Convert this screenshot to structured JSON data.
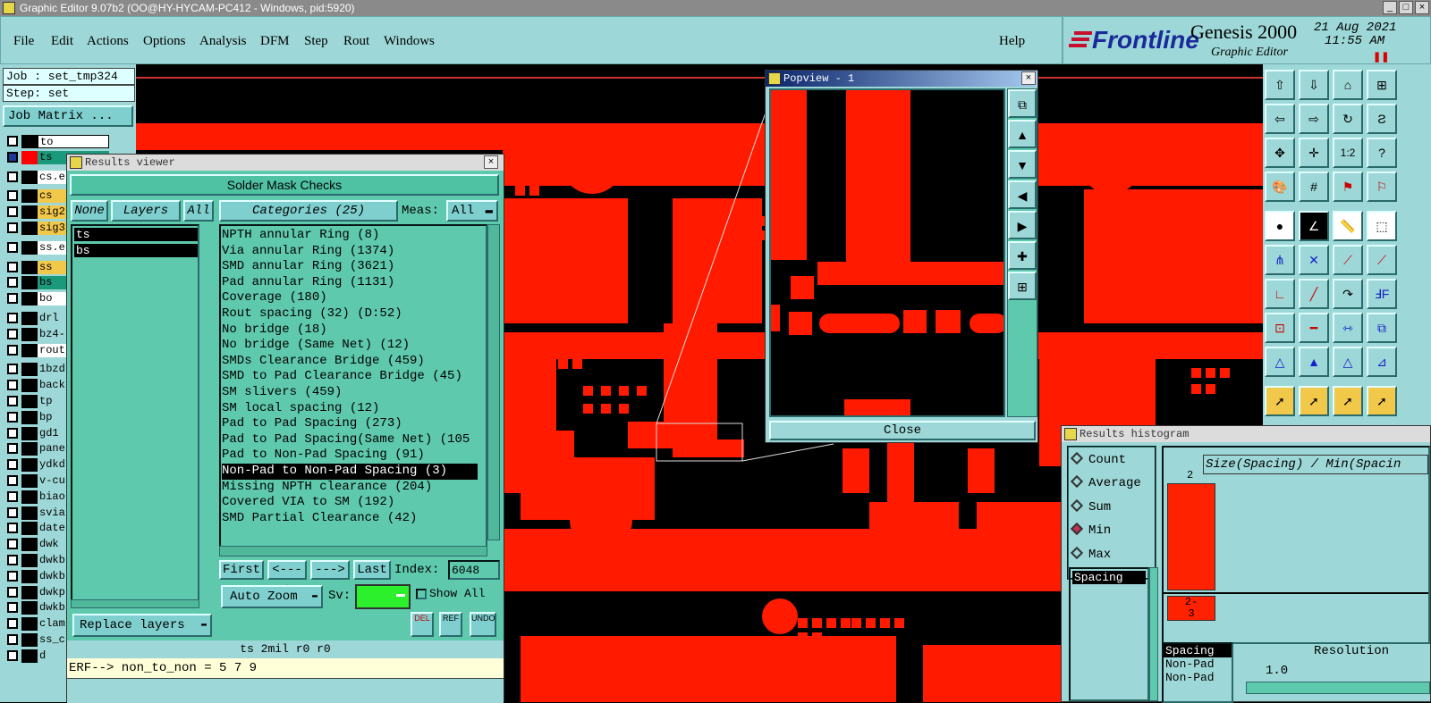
{
  "window": {
    "title": "Graphic Editor 9.07b2 (OO@HY-HYCAM-PC412 - Windows, pid:5920)"
  },
  "menu": {
    "items": [
      "File",
      "Edit",
      "Actions",
      "Options",
      "Analysis",
      "DFM",
      "Step",
      "Rout",
      "Windows"
    ],
    "help": "Help"
  },
  "brand": {
    "logo": "Frontline",
    "product": "Genesis 2000",
    "subtitle": "Graphic Editor",
    "date": "21 Aug 2021",
    "time": "11:55 AM"
  },
  "job": {
    "job_label": "Job : set_tmp324",
    "step_label": "Step: set",
    "matrix_button": "Job Matrix ..."
  },
  "layers": [
    {
      "name": "to",
      "color": "#ffffff"
    },
    {
      "name": "ts",
      "color": "#1a9a7a"
    },
    {
      "name": "cs.e",
      "color": "#ffffff"
    },
    {
      "name": "cs",
      "color": "#f2c84a"
    },
    {
      "name": "sig2",
      "color": "#f2c84a"
    },
    {
      "name": "sig3",
      "color": "#f2c84a"
    },
    {
      "name": "ss.e",
      "color": "#ffffff"
    },
    {
      "name": "ss",
      "color": "#f2c84a"
    },
    {
      "name": "bs",
      "color": "#1a9a7a"
    },
    {
      "name": "bo",
      "color": "#ffffff"
    },
    {
      "name": "drl",
      "color": "#9ed7d7"
    },
    {
      "name": "bz4-",
      "color": "#9ed7d7"
    },
    {
      "name": "rout",
      "color": "#ffffff"
    },
    {
      "name": "1bzd",
      "color": "#9ed7d7"
    },
    {
      "name": "back",
      "color": "#9ed7d7"
    },
    {
      "name": "tp",
      "color": "#9ed7d7"
    },
    {
      "name": "bp",
      "color": "#9ed7d7"
    },
    {
      "name": "gd1",
      "color": "#9ed7d7"
    },
    {
      "name": "pane",
      "color": "#9ed7d7"
    },
    {
      "name": "ydkd",
      "color": "#9ed7d7"
    },
    {
      "name": "v-cu",
      "color": "#9ed7d7"
    },
    {
      "name": "biao",
      "color": "#9ed7d7"
    },
    {
      "name": "svia",
      "color": "#9ed7d7"
    },
    {
      "name": "date",
      "color": "#9ed7d7"
    },
    {
      "name": "dwk",
      "color": "#9ed7d7"
    },
    {
      "name": "dwkb",
      "color": "#9ed7d7"
    },
    {
      "name": "dwkb",
      "color": "#9ed7d7"
    },
    {
      "name": "dwkp",
      "color": "#9ed7d7"
    },
    {
      "name": "dwkb",
      "color": "#9ed7d7"
    },
    {
      "name": "clam",
      "color": "#9ed7d7"
    },
    {
      "name": "ss_c",
      "color": "#9ed7d7"
    },
    {
      "name": "d",
      "color": "#9ed7d7"
    }
  ],
  "results_viewer": {
    "title": "Results viewer",
    "heading": "Solder Mask Checks",
    "none_btn": "None",
    "layers_btn": "Layers",
    "all_btn": "All",
    "categories_label": "Categories (25)",
    "meas_label": "Meas:",
    "meas_value": "All",
    "layer_list": [
      "ts",
      "bs"
    ],
    "categories": [
      "NPTH annular Ring (8)",
      "Via annular Ring (1374)",
      "SMD annular Ring (3621)",
      "Pad annular Ring (1131)",
      "Coverage (180)",
      "Rout spacing (32)          (D:52)",
      "No bridge (18)",
      "No bridge (Same Net) (12)",
      "SMDs Clearance Bridge (459)",
      "SMD to Pad Clearance Bridge (45)",
      "SM slivers (459)",
      "SM local spacing (12)",
      "Pad to Pad Spacing (273)",
      "Pad to Pad Spacing(Same Net) (105",
      "Pad to Non-Pad Spacing (91)",
      "Non-Pad to Non-Pad Spacing (3)",
      "Missing NPTH clearance (204)",
      "Covered VIA to SM (192)",
      "SMD Partial Clearance (42)"
    ],
    "selected_index": 15,
    "nav": {
      "first": "First",
      "prev": "<----",
      "next": "--->",
      "last": "Last",
      "index_label": "Index:",
      "index_value": "6048"
    },
    "auto_zoom": "Auto Zoom",
    "sv_label": "Sv:",
    "show_all": "Show All",
    "replace_layers": "Replace layers",
    "del": "DEL",
    "ref": "REF",
    "undo": "UNDO",
    "status": "ts 2mil   r0   r0",
    "erf": "ERF--> non_to_non = 5 7 9"
  },
  "popview": {
    "title": "Popview - 1",
    "close": "Close"
  },
  "histogram": {
    "title": "Results histogram",
    "options": [
      "Count",
      "Average",
      "Sum",
      "Min",
      "Max"
    ],
    "selected": "Min",
    "header": "Size(Spacing) / Min(Spacin",
    "list1": [
      "Spacing"
    ],
    "bar_value_label": "2",
    "bar_range_label": "2-\n3",
    "list2": [
      "Spacing",
      "Non-Pad",
      "Non-Pad"
    ],
    "resolution_label": "Resolution",
    "resolution_value": "1.0"
  },
  "colors": {
    "feature": "#ff1a00",
    "panel": "#9ed7d7",
    "viewer": "#5fc9ad"
  }
}
